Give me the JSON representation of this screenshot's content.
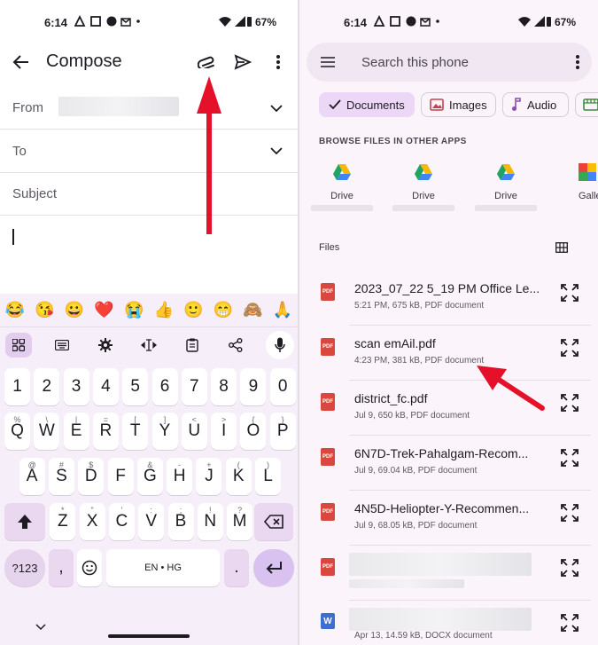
{
  "left_status": {
    "time": "6:14",
    "battery": "67%"
  },
  "right_status": {
    "time": "6:14",
    "battery": "67%"
  },
  "compose": {
    "title": "Compose",
    "from_label": "From",
    "to_label": "To",
    "subject_label": "Subject"
  },
  "keyboard": {
    "emojis": [
      "😂",
      "😘",
      "😀",
      "❤️",
      "😭",
      "👍",
      "🙂",
      "😁",
      "🙈",
      "🙏"
    ],
    "number_row": [
      "1",
      "2",
      "3",
      "4",
      "5",
      "6",
      "7",
      "8",
      "9",
      "0"
    ],
    "row1": [
      {
        "k": "Q",
        "s": "%"
      },
      {
        "k": "W",
        "s": "\\"
      },
      {
        "k": "E",
        "s": "|"
      },
      {
        "k": "R",
        "s": "="
      },
      {
        "k": "T",
        "s": "["
      },
      {
        "k": "Y",
        "s": "]"
      },
      {
        "k": "U",
        "s": "<"
      },
      {
        "k": "I",
        "s": ">"
      },
      {
        "k": "O",
        "s": "{"
      },
      {
        "k": "P",
        "s": "}"
      }
    ],
    "row2": [
      {
        "k": "A",
        "s": "@"
      },
      {
        "k": "S",
        "s": "#"
      },
      {
        "k": "D",
        "s": "$"
      },
      {
        "k": "F",
        "s": "_"
      },
      {
        "k": "G",
        "s": "&"
      },
      {
        "k": "H",
        "s": "-"
      },
      {
        "k": "J",
        "s": "+"
      },
      {
        "k": "K",
        "s": "("
      },
      {
        "k": "L",
        "s": ")"
      }
    ],
    "row3": [
      {
        "k": "Z",
        "s": "*"
      },
      {
        "k": "X",
        "s": "\""
      },
      {
        "k": "C",
        "s": "'"
      },
      {
        "k": "V",
        "s": ":"
      },
      {
        "k": "B",
        "s": ";"
      },
      {
        "k": "N",
        "s": "!"
      },
      {
        "k": "M",
        "s": "?"
      }
    ],
    "symbols_label": "?123",
    "comma_label": ",",
    "space_label": "EN • HG",
    "period_label": "."
  },
  "files_app": {
    "search_placeholder": "Search this phone",
    "chips": [
      {
        "label": "Documents",
        "selected": true,
        "icon": "check-icon"
      },
      {
        "label": "Images",
        "selected": false,
        "icon": "image-icon"
      },
      {
        "label": "Audio",
        "selected": false,
        "icon": "music-note-icon"
      }
    ],
    "browse_title": "BROWSE FILES IN OTHER APPS",
    "apps": [
      "Drive",
      "Drive",
      "Drive",
      "Galle"
    ],
    "files_title": "Files",
    "files": [
      {
        "name": "2023_07_22 5_19 PM Office Le...",
        "meta": "5:21 PM, 675 kB, PDF document",
        "type": "pdf"
      },
      {
        "name": "scan emAil.pdf",
        "meta": "4:23 PM, 381 kB, PDF document",
        "type": "pdf"
      },
      {
        "name": "district_fc.pdf",
        "meta": "Jul 9, 650 kB, PDF document",
        "type": "pdf"
      },
      {
        "name": "6N7D-Trek-Pahalgam-Recom...",
        "meta": "Jul 9, 69.04 kB, PDF document",
        "type": "pdf"
      },
      {
        "name": "4N5D-Heliopter-Y-Recommen...",
        "meta": "Jul 9, 68.05 kB, PDF document",
        "type": "pdf"
      },
      {
        "name": "",
        "meta": "",
        "type": "pdf"
      },
      {
        "name": "",
        "meta": "Apr 13, 14.59 kB, DOCX document",
        "type": "docx"
      }
    ],
    "pdf_badge": "PDF",
    "word_badge": "W"
  },
  "colors": {
    "accent": "#8d4bb5",
    "arrow": "#e5102a",
    "pdf": "#d8483f"
  }
}
